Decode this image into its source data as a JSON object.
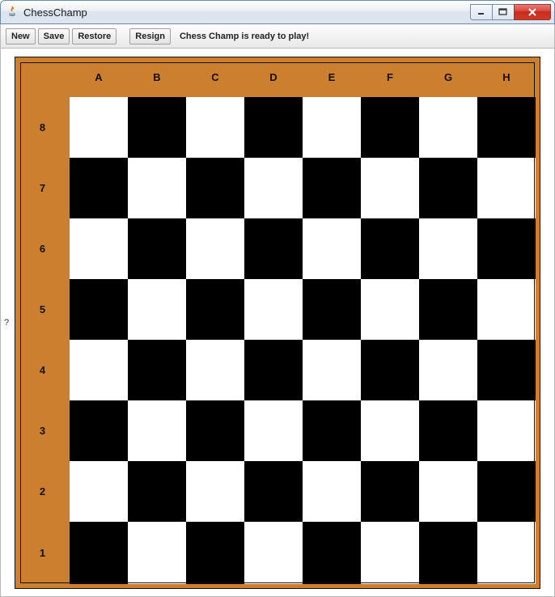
{
  "window": {
    "title": "ChessChamp"
  },
  "toolbar": {
    "new_label": "New",
    "save_label": "Save",
    "restore_label": "Restore",
    "resign_label": "Resign",
    "status": "Chess Champ is ready to play!"
  },
  "sidebar": {
    "qmark": "?"
  },
  "board": {
    "files": [
      "A",
      "B",
      "C",
      "D",
      "E",
      "F",
      "G",
      "H"
    ],
    "ranks": [
      "8",
      "7",
      "6",
      "5",
      "4",
      "3",
      "2",
      "1"
    ]
  }
}
